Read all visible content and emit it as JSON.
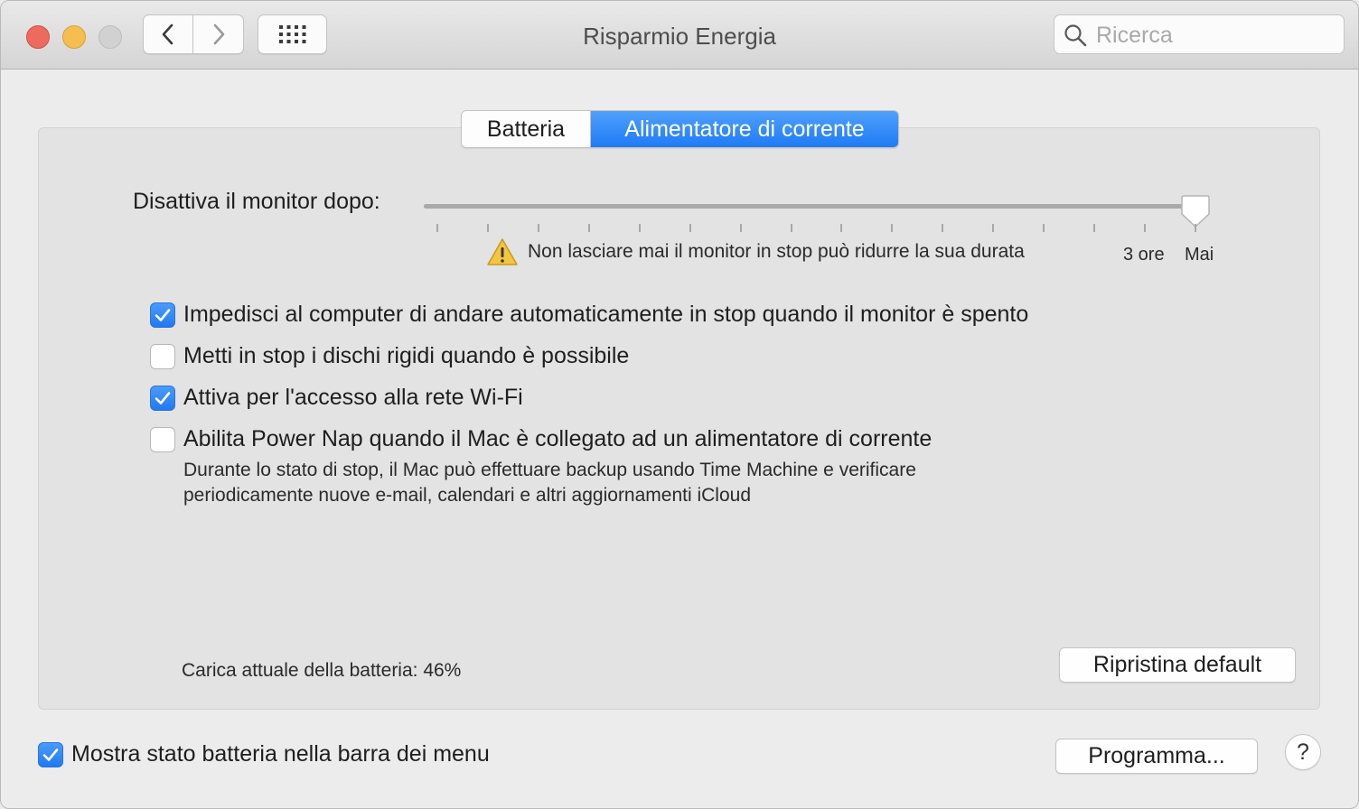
{
  "window": {
    "title": "Risparmio Energia",
    "search_placeholder": "Ricerca",
    "traffic_colors": {
      "close": "#ed6a5e",
      "minimize": "#f5bf4f",
      "zoom": "#d1d1d1"
    }
  },
  "toolbar": {
    "back_icon": "chevron-left-icon",
    "forward_icon": "chevron-right-icon",
    "grid_icon": "grid-icon"
  },
  "tabs": [
    {
      "label": "Batteria",
      "selected": false
    },
    {
      "label": "Alimentatore di corrente",
      "selected": true
    }
  ],
  "accent_color": "#2079f3",
  "display_sleep": {
    "label": "Disattiva il monitor dopo:",
    "value": "Mai",
    "position_fraction": 1.0,
    "warning_icon": "warning-icon",
    "warning": "Non lasciare mai il monitor in stop può ridurre la sua durata",
    "tick_labels": [
      "3 ore",
      "Mai"
    ]
  },
  "options": [
    {
      "label": "Impedisci al computer di andare automaticamente in stop quando il monitor è spento",
      "checked": true
    },
    {
      "label": "Metti in stop i dischi rigidi quando è possibile",
      "checked": false
    },
    {
      "label": "Attiva per l'accesso alla rete Wi-Fi",
      "checked": true
    },
    {
      "label": "Abilita Power Nap quando il Mac è collegato ad un alimentatore di corrente",
      "checked": false
    }
  ],
  "power_nap_description": [
    "Durante lo stato di stop, il Mac può effettuare backup usando Time Machine e verificare",
    "periodicamente nuove e-mail, calendari e altri aggiornamenti iCloud"
  ],
  "battery_charge": "Carica attuale della batteria: 46%",
  "restore_button": "Ripristina default",
  "show_battery_status": {
    "label": "Mostra stato batteria nella barra dei menu",
    "checked": true
  },
  "schedule_button": "Programma...",
  "help_button": "?"
}
